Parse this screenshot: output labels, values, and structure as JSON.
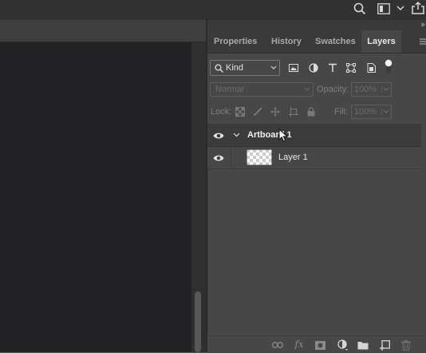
{
  "panel": {
    "tabs": [
      {
        "label": "Properties",
        "active": false
      },
      {
        "label": "History",
        "active": false
      },
      {
        "label": "Swatches",
        "active": false
      },
      {
        "label": "Layers",
        "active": true
      }
    ],
    "filter_kind": "Kind",
    "blend_mode": "Normal",
    "opacity_label": "Opacity:",
    "opacity_value": "100%",
    "lock_label": "Lock:",
    "fill_label": "Fill:",
    "fill_value": "100%"
  },
  "layers": [
    {
      "name": "Artboard 1",
      "type": "artboard",
      "expanded": true,
      "visible": true,
      "selected": true
    },
    {
      "name": "Layer 1",
      "type": "pixel",
      "visible": true,
      "selected": false
    }
  ],
  "icons": {
    "topbar": [
      "search-icon",
      "workspace-icon",
      "chevron-down-icon",
      "share-icon"
    ],
    "filters": [
      "image-filter-icon",
      "adjustment-filter-icon",
      "type-filter-icon",
      "shape-filter-icon",
      "smart-object-filter-icon",
      "filter-toggle-icon"
    ],
    "locks": [
      "lock-transparent-icon",
      "lock-image-icon",
      "lock-position-icon",
      "lock-artboard-icon",
      "lock-all-icon"
    ],
    "bottom": [
      "link-icon",
      "fx-icon",
      "mask-icon",
      "adjustment-icon",
      "group-icon",
      "new-layer-icon",
      "trash-icon"
    ]
  },
  "colors": {
    "panel_bg": "#474747",
    "tab_bar_bg": "#3a3a3a",
    "canvas_bg": "#222123",
    "selected_row": "#3b3b3b"
  }
}
